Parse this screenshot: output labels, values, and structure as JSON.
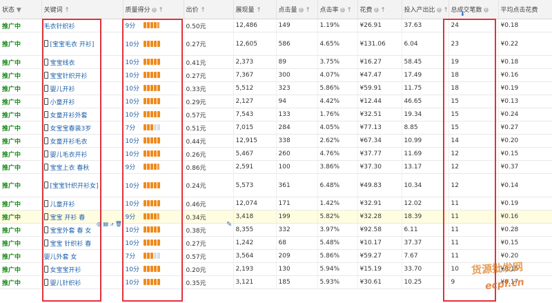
{
  "headers": {
    "status": "状态",
    "keyword": "关键词",
    "score": "质量得分",
    "price": "出价",
    "impressions": "展现量",
    "clicks": "点击量",
    "ctr": "点击率",
    "spend": "花费",
    "roi": "投入产出比",
    "deals": "总成交笔数",
    "avg_cpc": "平均点击花费"
  },
  "rows": [
    {
      "status": "推广中",
      "mobile": false,
      "keyword": "毛衣针织衫",
      "score": "9分",
      "level": 9,
      "price": "0.50元",
      "impressions": "12,486",
      "clicks": "149",
      "ctr": "1.19%",
      "spend": "¥26.91",
      "roi": "37.63",
      "deals": "24",
      "avg_cpc": "¥0.18",
      "tall": false,
      "hl": false
    },
    {
      "status": "推广中",
      "mobile": true,
      "keyword": "[宝宝毛衣 开衫]",
      "score": "10分",
      "level": 10,
      "price": "0.27元",
      "impressions": "12,605",
      "clicks": "586",
      "ctr": "4.65%",
      "spend": "¥131.06",
      "roi": "6.04",
      "deals": "23",
      "avg_cpc": "¥0.22",
      "tall": true,
      "hl": false
    },
    {
      "status": "推广中",
      "mobile": true,
      "keyword": "宝宝线衣",
      "score": "10分",
      "level": 10,
      "price": "0.41元",
      "impressions": "2,373",
      "clicks": "89",
      "ctr": "3.75%",
      "spend": "¥16.27",
      "roi": "58.45",
      "deals": "19",
      "avg_cpc": "¥0.18",
      "tall": false,
      "hl": false
    },
    {
      "status": "推广中",
      "mobile": true,
      "keyword": "宝宝针织开衫",
      "score": "10分",
      "level": 10,
      "price": "0.27元",
      "impressions": "7,367",
      "clicks": "300",
      "ctr": "4.07%",
      "spend": "¥47.47",
      "roi": "17.49",
      "deals": "18",
      "avg_cpc": "¥0.16",
      "tall": false,
      "hl": false
    },
    {
      "status": "推广中",
      "mobile": true,
      "keyword": "婴儿开衫",
      "score": "10分",
      "level": 10,
      "price": "0.33元",
      "impressions": "5,512",
      "clicks": "323",
      "ctr": "5.86%",
      "spend": "¥59.91",
      "roi": "11.75",
      "deals": "18",
      "avg_cpc": "¥0.19",
      "tall": false,
      "hl": false
    },
    {
      "status": "推广中",
      "mobile": true,
      "keyword": "小童开衫",
      "score": "10分",
      "level": 10,
      "price": "0.29元",
      "impressions": "2,127",
      "clicks": "94",
      "ctr": "4.42%",
      "spend": "¥12.44",
      "roi": "46.65",
      "deals": "15",
      "avg_cpc": "¥0.13",
      "tall": false,
      "hl": false
    },
    {
      "status": "推广中",
      "mobile": true,
      "keyword": "女童开衫外套",
      "score": "10分",
      "level": 10,
      "price": "0.57元",
      "impressions": "7,543",
      "clicks": "133",
      "ctr": "1.76%",
      "spend": "¥32.51",
      "roi": "19.34",
      "deals": "15",
      "avg_cpc": "¥0.24",
      "tall": false,
      "hl": false
    },
    {
      "status": "推广中",
      "mobile": true,
      "keyword": "女宝宝春装3岁",
      "score": "7分",
      "level": 7,
      "price": "0.51元",
      "impressions": "7,015",
      "clicks": "284",
      "ctr": "4.05%",
      "spend": "¥77.13",
      "roi": "8.85",
      "deals": "15",
      "avg_cpc": "¥0.27",
      "tall": false,
      "hl": false
    },
    {
      "status": "推广中",
      "mobile": true,
      "keyword": "女童开衫毛衣",
      "score": "10分",
      "level": 10,
      "price": "0.44元",
      "impressions": "12,915",
      "clicks": "338",
      "ctr": "2.62%",
      "spend": "¥67.34",
      "roi": "10.99",
      "deals": "14",
      "avg_cpc": "¥0.20",
      "tall": false,
      "hl": false
    },
    {
      "status": "推广中",
      "mobile": true,
      "keyword": "婴儿毛衣开衫",
      "score": "10分",
      "level": 10,
      "price": "0.26元",
      "impressions": "5,467",
      "clicks": "260",
      "ctr": "4.76%",
      "spend": "¥37.77",
      "roi": "11.69",
      "deals": "12",
      "avg_cpc": "¥0.15",
      "tall": false,
      "hl": false
    },
    {
      "status": "推广中",
      "mobile": true,
      "keyword": "宝宝上衣 春秋",
      "score": "9分",
      "level": 9,
      "price": "0.86元",
      "impressions": "2,591",
      "clicks": "100",
      "ctr": "3.86%",
      "spend": "¥37.30",
      "roi": "13.17",
      "deals": "12",
      "avg_cpc": "¥0.37",
      "tall": false,
      "hl": false
    },
    {
      "status": "推广中",
      "mobile": true,
      "keyword": "[宝宝针织开衫女]",
      "score": "10分",
      "level": 10,
      "price": "0.24元",
      "impressions": "5,573",
      "clicks": "361",
      "ctr": "6.48%",
      "spend": "¥49.83",
      "roi": "10.34",
      "deals": "12",
      "avg_cpc": "¥0.14",
      "tall": true,
      "hl": false
    },
    {
      "status": "推广中",
      "mobile": true,
      "keyword": "儿童开衫",
      "score": "10分",
      "level": 10,
      "price": "0.46元",
      "impressions": "12,074",
      "clicks": "171",
      "ctr": "1.42%",
      "spend": "¥32.91",
      "roi": "12.02",
      "deals": "11",
      "avg_cpc": "¥0.19",
      "tall": false,
      "hl": false
    },
    {
      "status": "推广中",
      "mobile": true,
      "keyword": "宝宝 开衫 春",
      "score": "9分",
      "level": 9,
      "price": "0.34元",
      "impressions": "3,418",
      "clicks": "199",
      "ctr": "5.82%",
      "spend": "¥32.28",
      "roi": "18.39",
      "deals": "11",
      "avg_cpc": "¥0.16",
      "tall": false,
      "hl": true
    },
    {
      "status": "推广中",
      "mobile": true,
      "keyword": "宝宝外套 春 女",
      "score": "10分",
      "level": 10,
      "price": "0.38元",
      "impressions": "8,355",
      "clicks": "332",
      "ctr": "3.97%",
      "spend": "¥92.58",
      "roi": "6.11",
      "deals": "11",
      "avg_cpc": "¥0.28",
      "tall": false,
      "hl": false
    },
    {
      "status": "推广中",
      "mobile": true,
      "keyword": "宝宝 针织衫 春",
      "score": "10分",
      "level": 10,
      "price": "0.27元",
      "impressions": "1,242",
      "clicks": "68",
      "ctr": "5.48%",
      "spend": "¥10.17",
      "roi": "37.37",
      "deals": "11",
      "avg_cpc": "¥0.15",
      "tall": false,
      "hl": false
    },
    {
      "status": "推广中",
      "mobile": false,
      "keyword": "婴儿外套 女",
      "score": "7分",
      "level": 7,
      "price": "0.57元",
      "impressions": "3,564",
      "clicks": "209",
      "ctr": "5.86%",
      "spend": "¥59.27",
      "roi": "7.67",
      "deals": "11",
      "avg_cpc": "¥0.20",
      "tall": false,
      "hl": false
    },
    {
      "status": "推广中",
      "mobile": true,
      "keyword": "女宝宝开衫",
      "score": "10分",
      "level": 10,
      "price": "0.20元",
      "impressions": "2,193",
      "clicks": "130",
      "ctr": "5.94%",
      "spend": "¥15.19",
      "roi": "33.70",
      "deals": "10",
      "avg_cpc": "¥0.15",
      "tall": false,
      "hl": false
    },
    {
      "status": "推广中",
      "mobile": true,
      "keyword": "婴儿针织衫",
      "score": "10分",
      "level": 10,
      "price": "0.35元",
      "impressions": "3,121",
      "clicks": "185",
      "ctr": "5.93%",
      "spend": "¥30.61",
      "roi": "10.25",
      "deals": "9",
      "avg_cpc": "¥0.17",
      "tall": false,
      "hl": false
    }
  ],
  "watermark": "货源批发网",
  "watermark_url": "ecpf.cn",
  "colors": {
    "status": "#1a8a1a",
    "keyword": "#1a5ea8",
    "bar_on": "#f08a1c",
    "bar_off": "#d8dde6",
    "highlight": "#e0303a"
  }
}
